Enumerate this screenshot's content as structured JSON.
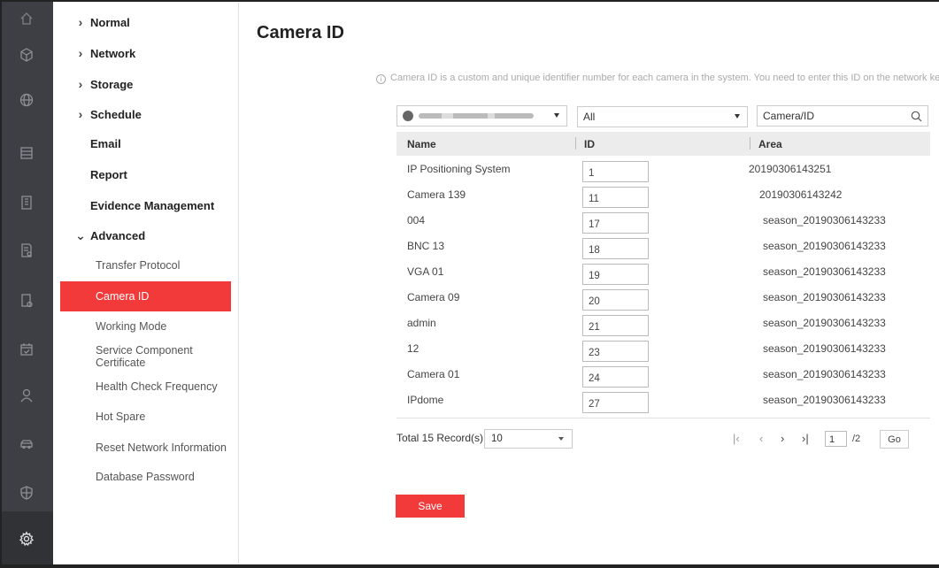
{
  "rail": {
    "icons": [
      "home-icon",
      "cube-icon",
      "globe-icon",
      "storage-icon",
      "building-icon",
      "report-icon",
      "schedule-icon",
      "calendar-icon",
      "person-icon",
      "vehicle-icon",
      "shield-icon",
      "gear-icon"
    ]
  },
  "nav": {
    "normal": "Normal",
    "network": "Network",
    "storage": "Storage",
    "schedule": "Schedule",
    "email": "Email",
    "report": "Report",
    "evidence": "Evidence Management",
    "advanced": "Advanced",
    "sub": [
      "Transfer Protocol",
      "Camera ID",
      "Working Mode",
      "Service Component Certificate",
      "Health Check Frequency",
      "Hot Spare",
      "Reset Network Information",
      "Database Password"
    ]
  },
  "main": {
    "title": "Camera ID",
    "info": "Camera ID is a custom and unique identifier number for each camera in the system. You need to enter this ID on the network keyboard to search the camera.",
    "filter_type": "All",
    "search_placeholder": "Camera/ID",
    "columns": {
      "name": "Name",
      "id": "ID",
      "area": "Area"
    },
    "rows": [
      {
        "name": "IP Positioning System",
        "id": "1",
        "area": "20190306143251"
      },
      {
        "name": "Camera 139",
        "id": "11",
        "area": "20190306143242"
      },
      {
        "name": "004",
        "id": "17",
        "area": "season_20190306143233"
      },
      {
        "name": "BNC 13",
        "id": "18",
        "area": "season_20190306143233"
      },
      {
        "name": "VGA 01",
        "id": "19",
        "area": "season_20190306143233"
      },
      {
        "name": "Camera 09",
        "id": "20",
        "area": "season_20190306143233"
      },
      {
        "name": "admin",
        "id": "21",
        "area": "season_20190306143233"
      },
      {
        "name": "12",
        "id": "23",
        "area": "season_20190306143233"
      },
      {
        "name": "Camera 01",
        "id": "24",
        "area": "season_20190306143233"
      },
      {
        "name": "IPdome",
        "id": "27",
        "area": "season_20190306143233"
      }
    ],
    "pagination": {
      "total": "Total 15 Record(s)",
      "page_size": "10",
      "current_page": "1",
      "total_pages": "/2",
      "go": "Go"
    },
    "save": "Save"
  },
  "colors": {
    "accent": "#f33a3a",
    "rail": "#3d3f44"
  }
}
